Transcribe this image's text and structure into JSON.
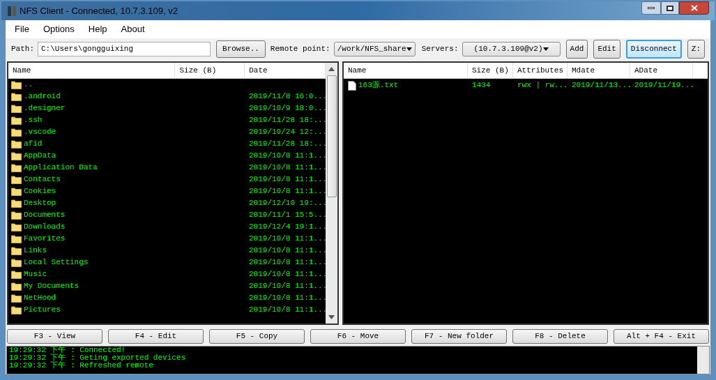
{
  "window": {
    "title": "NFS Client - Connected, 10.7.3.109, v2"
  },
  "menu": [
    "File",
    "Options",
    "Help",
    "About"
  ],
  "toolbar": {
    "path_label": "Path:",
    "path_value": "C:\\Users\\gongguixing",
    "browse": "Browse..",
    "remote_label": "Remote point:",
    "remote_value": "/work/NFS_share",
    "servers_label": "Servers:",
    "servers_value": "(10.7.3.109@v2)",
    "buttons": [
      {
        "label": "Add",
        "selected": false
      },
      {
        "label": "Edit",
        "selected": false
      },
      {
        "label": "Disconnect",
        "selected": true
      },
      {
        "label": "Z:",
        "selected": false
      }
    ]
  },
  "local": {
    "columns": [
      "Name",
      "Size (B)",
      "Date"
    ],
    "rows": [
      {
        "kind": "folder",
        "name": "..",
        "date": ""
      },
      {
        "kind": "folder",
        "name": ".android",
        "date": "2019/11/8 16:0..."
      },
      {
        "kind": "folder",
        "name": ".designer",
        "date": "2019/10/9 18:0..."
      },
      {
        "kind": "folder",
        "name": ".ssh",
        "date": "2019/11/28 18:..."
      },
      {
        "kind": "folder",
        "name": ".vscode",
        "date": "2019/10/24 12:..."
      },
      {
        "kind": "folder",
        "name": "afid",
        "date": "2019/11/28 18:..."
      },
      {
        "kind": "folder",
        "name": "AppData",
        "date": "2019/10/8 11:1..."
      },
      {
        "kind": "folder",
        "name": "Application Data",
        "date": "2019/10/8 11:1..."
      },
      {
        "kind": "folder",
        "name": "Contacts",
        "date": "2019/10/8 11:1..."
      },
      {
        "kind": "folder",
        "name": "Cookies",
        "date": "2019/10/8 11:1..."
      },
      {
        "kind": "folder",
        "name": "Desktop",
        "date": "2019/12/10 19:..."
      },
      {
        "kind": "folder",
        "name": "Documents",
        "date": "2019/11/1 15:5..."
      },
      {
        "kind": "folder",
        "name": "Downloads",
        "date": "2019/12/4 19:1..."
      },
      {
        "kind": "folder",
        "name": "Favorites",
        "date": "2019/10/8 11:1..."
      },
      {
        "kind": "folder",
        "name": "Links",
        "date": "2019/10/8 11:1..."
      },
      {
        "kind": "folder",
        "name": "Local Settings",
        "date": "2019/10/8 11:1..."
      },
      {
        "kind": "folder",
        "name": "Music",
        "date": "2019/10/8 11:1..."
      },
      {
        "kind": "folder",
        "name": "My Documents",
        "date": "2019/10/8 11:1..."
      },
      {
        "kind": "folder",
        "name": "NetHood",
        "date": "2019/10/8 11:1..."
      },
      {
        "kind": "folder",
        "name": "Pictures",
        "date": "2019/10/8 11:1..."
      }
    ]
  },
  "remote": {
    "columns": [
      "Name",
      "Size (B)",
      "Attributes",
      "Mdate",
      "ADate"
    ],
    "rows": [
      {
        "kind": "file",
        "cells": [
          "163源.txt",
          "1434",
          "rwx | rw...",
          "2019/11/13...",
          "2019/11/19..."
        ]
      }
    ]
  },
  "actions": [
    "F3 - View",
    "F4 - Edit",
    "F5 - Copy",
    "F6 - Move",
    "F7 - New folder",
    "F8 - Delete",
    "Alt + F4 - Exit"
  ],
  "log": [
    "19:29:32 下午 : Connected!",
    "19:29:32 下午 : Geting exported devices",
    "19:29:32 下午 : Refreshed remote"
  ]
}
